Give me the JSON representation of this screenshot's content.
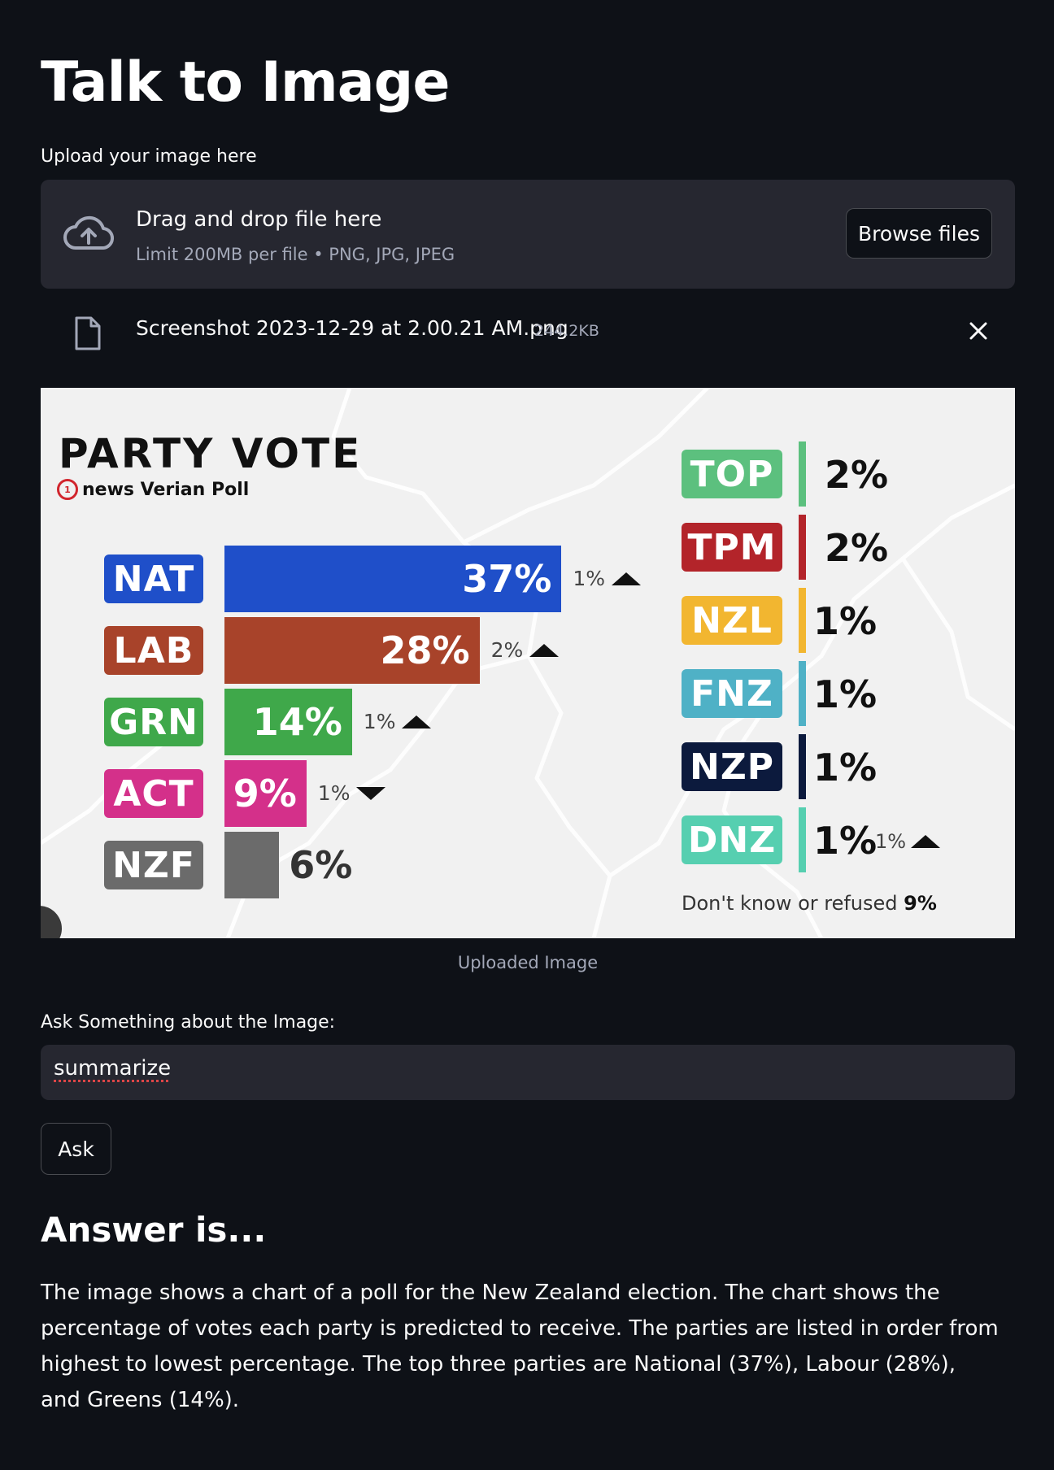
{
  "page": {
    "title": "Talk to Image",
    "upload_label": "Upload your image here"
  },
  "uploader": {
    "drag_text": "Drag and drop file here",
    "limit_text": "Limit 200MB per file • PNG, JPG, JPEG",
    "browse_label": "Browse files",
    "icon": "cloud-upload-icon"
  },
  "file": {
    "name": "Screenshot 2023-12-29 at 2.00.21 AM.png",
    "size": "244.2KB",
    "icon": "file-icon",
    "remove_icon": "close-icon"
  },
  "image_caption": "Uploaded Image",
  "chart_data": {
    "type": "bar",
    "title": "PARTY VOTE",
    "subtitle": "news Verian Poll",
    "logo_text": "1",
    "series": [
      {
        "party": "NAT",
        "value": 37,
        "label": "37%",
        "change": "1%",
        "direction": "up",
        "color": "#1f4fc9"
      },
      {
        "party": "LAB",
        "value": 28,
        "label": "28%",
        "change": "2%",
        "direction": "up",
        "color": "#a8432a"
      },
      {
        "party": "GRN",
        "value": 14,
        "label": "14%",
        "change": "1%",
        "direction": "up",
        "color": "#3fa84a"
      },
      {
        "party": "ACT",
        "value": 9,
        "label": "9%",
        "change": "1%",
        "direction": "down",
        "color": "#d4308a"
      },
      {
        "party": "NZF",
        "value": 6,
        "label": "6%",
        "change": "",
        "direction": "",
        "color": "#6b6b6b"
      }
    ],
    "minor_parties": [
      {
        "party": "TOP",
        "value": 2,
        "label": "2%",
        "change": "",
        "color": "#5cc07e"
      },
      {
        "party": "TPM",
        "value": 2,
        "label": "2%",
        "change": "",
        "color": "#b3242a"
      },
      {
        "party": "NZL",
        "value": 1,
        "label": "1%",
        "change": "",
        "color": "#f2b630"
      },
      {
        "party": "FNZ",
        "value": 1,
        "label": "1%",
        "change": "",
        "color": "#4fb1c6"
      },
      {
        "party": "NZP",
        "value": 1,
        "label": "1%",
        "change": "",
        "color": "#0c1a3d"
      },
      {
        "party": "DNZ",
        "value": 1,
        "label": "1%",
        "change": "1%",
        "direction": "up",
        "color": "#56cfb0"
      }
    ],
    "footnote": "Don't know or refused",
    "footnote_value": "9%"
  },
  "question": {
    "label": "Ask Something about the Image:",
    "value": "summarize"
  },
  "ask_label": "Ask",
  "answer": {
    "heading": "Answer is...",
    "text": "The image shows a chart of a poll for the New Zealand election. The chart shows the percentage of votes each party is predicted to receive. The parties are listed in order from highest to lowest percentage. The top three parties are National (37%), Labour (28%), and Greens (14%)."
  }
}
